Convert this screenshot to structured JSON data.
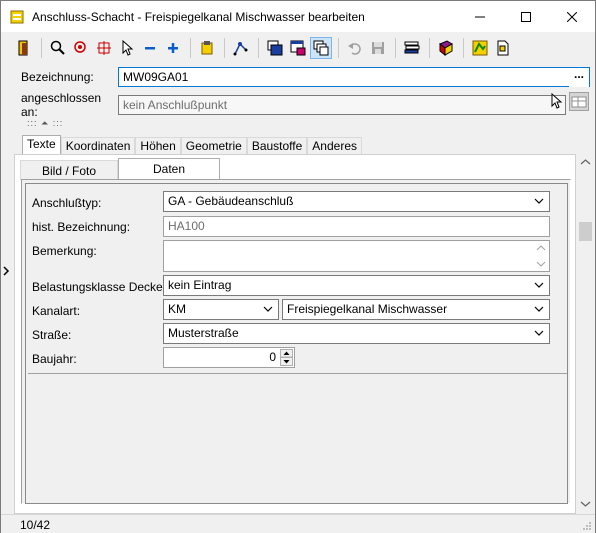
{
  "window": {
    "title": "Anschluss-Schacht - Freispiegelkanal Mischwasser bearbeiten"
  },
  "toolbar": {
    "buttons": [
      "exit-icon",
      "zoom-icon",
      "zoom-fit-icon",
      "crosshair-icon",
      "pointer-icon",
      "zoom-out-icon",
      "zoom-in-icon",
      "settings-icon",
      "node-edit-icon",
      "window-fill-icon",
      "window-pick-icon",
      "window-multi-icon",
      "undo-icon",
      "save-icon",
      "stack-icon",
      "book-icon",
      "map-icon",
      "document-icon"
    ]
  },
  "header": {
    "bezeichnung_label": "Bezeichnung:",
    "bezeichnung_value": "MW09GA01",
    "dots_label": "...",
    "angeschlossen_label": "angeschlossen an:",
    "angeschlossen_value": "kein Anschlußpunkt",
    "grip": "::: ⏶ :::"
  },
  "tabs": [
    "Texte",
    "Koordinaten",
    "Höhen",
    "Geometrie",
    "Baustoffe",
    "Anderes"
  ],
  "subtabs": [
    "Bild / Foto",
    "Daten"
  ],
  "form": {
    "anschlusstyp_label": "Anschlußtyp:",
    "anschlusstyp_value": "GA - Gebäudeanschluß",
    "hist_label": "hist. Bezeichnung:",
    "hist_value": "HA100",
    "bemerkung_label": "Bemerkung:",
    "bemerkung_value": "",
    "belastung_label": "Belastungsklasse Deckel:",
    "belastung_value": "kein Eintrag",
    "kanalart_label": "Kanalart:",
    "kanalart_code": "KM",
    "kanalart_value": "Freispiegelkanal Mischwasser",
    "strasse_label": "Straße:",
    "strasse_value": "Musterstraße",
    "baujahr_label": "Baujahr:",
    "baujahr_value": "0"
  },
  "status": {
    "record": "10/42"
  },
  "colors": {
    "focus_border": "#0078d7",
    "window_bg": "#f0f0f0"
  }
}
